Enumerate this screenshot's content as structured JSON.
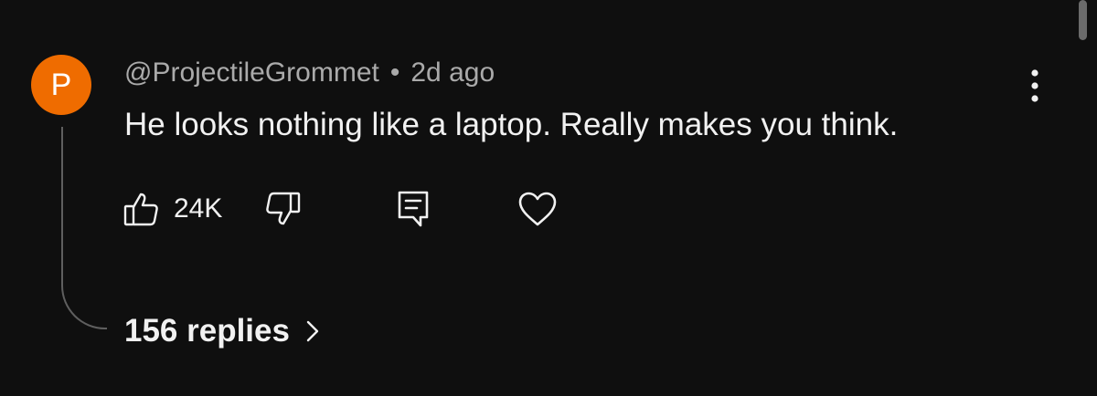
{
  "comment": {
    "avatar_letter": "P",
    "avatar_color": "#ef6c00",
    "author": "@ProjectileGrommet",
    "separator": "•",
    "time": "2d ago",
    "text": "He looks nothing like a laptop. Really makes you think."
  },
  "actions": {
    "like_icon": "thumbs-up-icon",
    "like_count": "24K",
    "dislike_icon": "thumbs-down-icon",
    "reply_icon": "comment-icon",
    "heart_icon": "heart-icon",
    "more_icon": "more-vert-icon"
  },
  "replies": {
    "label": "156 replies",
    "icon": "chevron-right-icon"
  },
  "colors": {
    "background": "#0f0f0f",
    "primary_text": "#f1f1f1",
    "secondary_text": "#aaaaaa",
    "thread_line": "#5f5f5f"
  }
}
